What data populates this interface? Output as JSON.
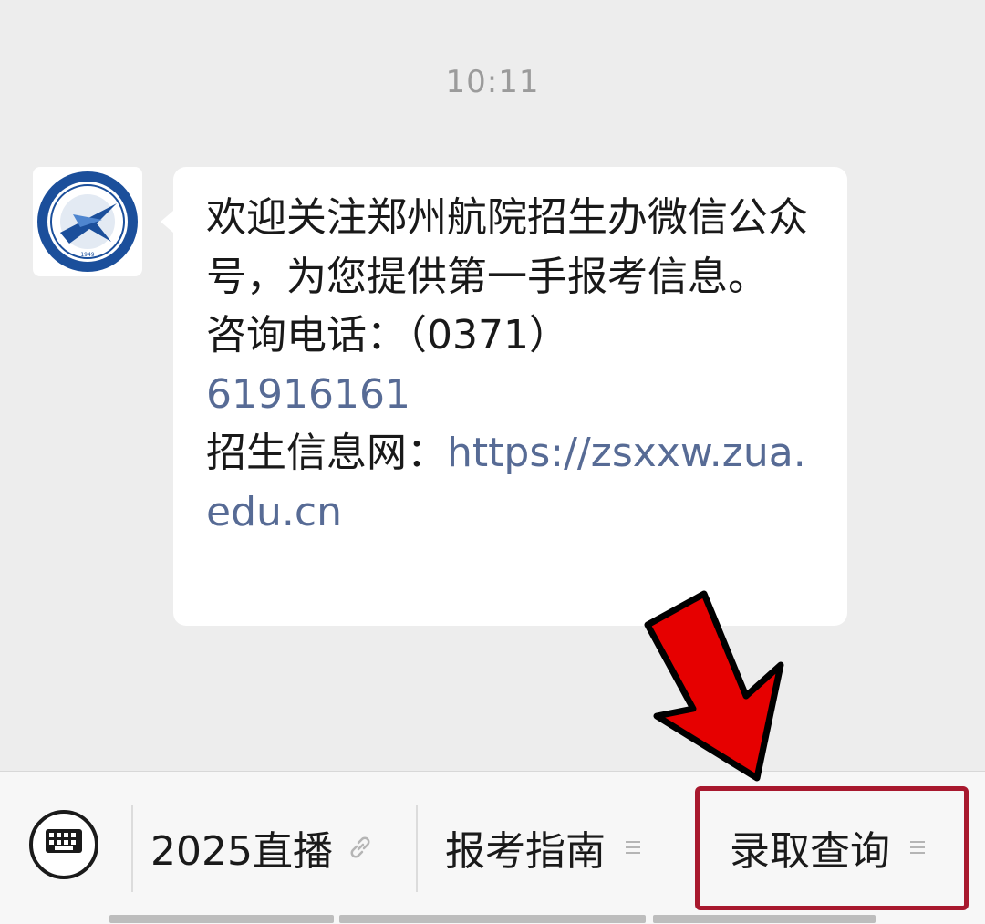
{
  "chat": {
    "timestamp": "10:11",
    "sender": {
      "avatar_icon": "zua-university-logo-icon",
      "logo_year": "1949"
    },
    "message": {
      "line1": "欢迎关注郑州航院招生办微信公众号，为您提供第一手报考信息。",
      "phone_label": "咨询电话：（0371）",
      "phone_number": "61916161",
      "site_label": "招生信息网：",
      "site_url": "https://zsxxw.zua.edu.cn"
    }
  },
  "bottom_menu": {
    "keyboard_icon": "keyboard-icon",
    "items": [
      {
        "label": "2025直播",
        "icon": "link-icon"
      },
      {
        "label": "报考指南",
        "icon": "menu-lines-icon"
      },
      {
        "label": "录取查询",
        "icon": "menu-lines-icon"
      }
    ]
  },
  "annotation": {
    "arrow_color": "#e60000",
    "box_color": "#a8192e"
  }
}
